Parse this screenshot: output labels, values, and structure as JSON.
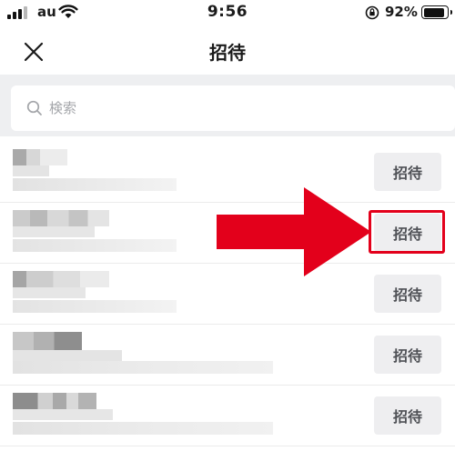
{
  "status_bar": {
    "carrier": "au",
    "time": "9:56",
    "battery_percent": "92%",
    "battery_level": 0.92
  },
  "nav": {
    "title": "招待"
  },
  "search": {
    "placeholder": "検索",
    "value": ""
  },
  "contacts": [
    {
      "invite_label": "招待"
    },
    {
      "invite_label": "招待"
    },
    {
      "invite_label": "招待"
    },
    {
      "invite_label": "招待"
    },
    {
      "invite_label": "招待"
    }
  ],
  "colors": {
    "annotation_red": "#e3001b",
    "button_bg": "#eeeef0",
    "search_bg": "#eeeff1"
  }
}
